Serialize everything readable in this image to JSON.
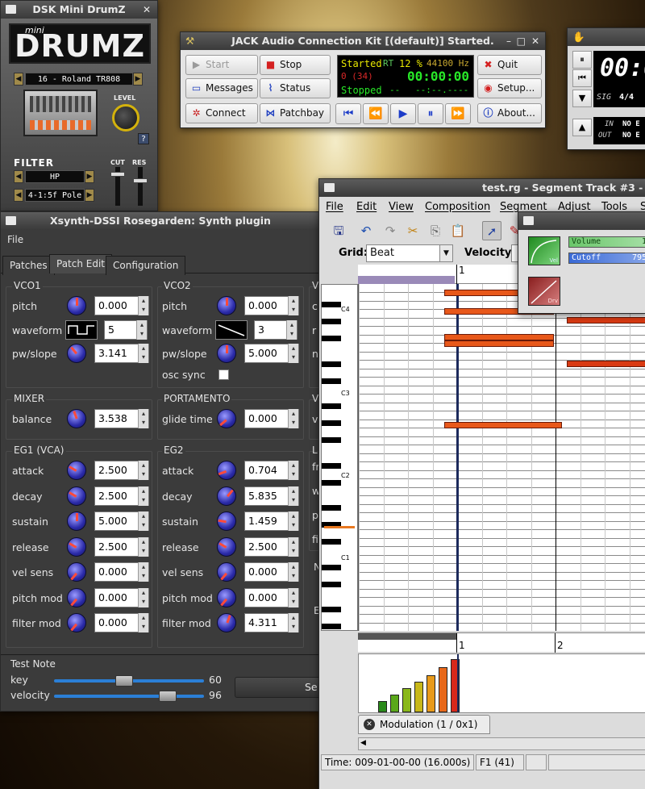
{
  "drumz": {
    "title": "DSK Mini DrumZ",
    "logo_mini": "mini",
    "logo_main": "DRUMZ",
    "kit": "16 - Roland TR808",
    "level_label": "LEVEL",
    "help": "?",
    "filter_label": "FILTER",
    "cut_label": "CUT",
    "res_label": "RES",
    "filter_type": "HP",
    "filter_slope": "4-1:5f Pole"
  },
  "jack": {
    "title": "JACK Audio Connection Kit [(default)] Started.",
    "buttons": {
      "start": "Start",
      "stop": "Stop",
      "quit": "Quit",
      "messages": "Messages",
      "status": "Status",
      "setup": "Setup...",
      "connect": "Connect",
      "patchbay": "Patchbay",
      "about": "About..."
    },
    "lcd": {
      "state": "Started",
      "rt": "RT",
      "cpu": "12 %",
      "rate": "44100 Hz",
      "xruns": "0 (34)",
      "time": "00:00:00",
      "transport": "Stopped",
      "dash": "--",
      "bbt": "--:--.----"
    }
  },
  "clock": {
    "time": "00:0",
    "sig_label": "SIG",
    "sig_value": "4/4",
    "in_label": "IN",
    "in_value": "NO E",
    "out_label": "OUT",
    "out_value": "NO E"
  },
  "xsynth": {
    "title": "Xsynth-DSSI Rosegarden: Synth plugin",
    "menu": {
      "file": "File"
    },
    "tabs": [
      "Patches",
      "Patch Edit",
      "Configuration"
    ],
    "vco1": {
      "title": "VCO1",
      "pitch_label": "pitch",
      "pitch": "0.000",
      "waveform_label": "waveform",
      "waveform": "5",
      "pw_label": "pw/slope",
      "pw": "3.141"
    },
    "vco2": {
      "title": "VCO2",
      "pitch_label": "pitch",
      "pitch": "0.000",
      "waveform_label": "waveform",
      "waveform": "3",
      "pw_label": "pw/slope",
      "pw": "5.000",
      "sync_label": "osc sync"
    },
    "mixer": {
      "title": "MIXER",
      "balance_label": "balance",
      "balance": "3.538"
    },
    "portamento": {
      "title": "PORTAMENTO",
      "glide_label": "glide time",
      "glide": "0.000"
    },
    "eg1": {
      "title": "EG1 (VCA)",
      "rows": [
        {
          "label": "attack",
          "value": "2.500"
        },
        {
          "label": "decay",
          "value": "2.500"
        },
        {
          "label": "sustain",
          "value": "5.000"
        },
        {
          "label": "release",
          "value": "2.500"
        },
        {
          "label": "vel sens",
          "value": "0.000"
        },
        {
          "label": "pitch mod",
          "value": "0.000"
        },
        {
          "label": "filter mod",
          "value": "0.000"
        }
      ]
    },
    "eg2": {
      "title": "EG2",
      "rows": [
        {
          "label": "attack",
          "value": "0.704"
        },
        {
          "label": "decay",
          "value": "5.835"
        },
        {
          "label": "sustain",
          "value": "1.459"
        },
        {
          "label": "release",
          "value": "2.500"
        },
        {
          "label": "vel sens",
          "value": "0.000"
        },
        {
          "label": "pitch mod",
          "value": "0.000"
        },
        {
          "label": "filter mod",
          "value": "4.311"
        }
      ]
    },
    "right_labels": [
      "V",
      "c",
      "r",
      "n",
      "V",
      "v",
      "L",
      "fr",
      "w",
      "p",
      "fi",
      "N",
      "E"
    ],
    "testnote": {
      "title": "Test Note",
      "key_label": "key",
      "key_value": "60",
      "key_fraction": 0.47,
      "velocity_label": "velocity",
      "velocity_value": "96",
      "velocity_fraction": 0.76,
      "send_label": "Se"
    }
  },
  "rg": {
    "title": "test.rg - Segment Track #3 -",
    "menu": [
      "File",
      "Edit",
      "View",
      "Composition",
      "Segment",
      "Adjust",
      "Tools",
      "S"
    ],
    "grid_label": "Grid:",
    "grid_value": "Beat",
    "velocity_label": "Velocity:",
    "ruler": [
      "1",
      "1",
      "2"
    ],
    "octaves": [
      "C4",
      "C3",
      "C2",
      "C1"
    ],
    "controller_tab": "Modulation (1 / 0x1)",
    "status_time": "Time: 009-01-00-00 (16.000s)",
    "status_note": "F1 (41)"
  },
  "mixpop": {
    "volume_label": "Volume",
    "volume_value": "1",
    "cutoff_label": "Cutoff",
    "cutoff_value": "795",
    "thumb1": "Vel",
    "thumb2": "Drv"
  }
}
